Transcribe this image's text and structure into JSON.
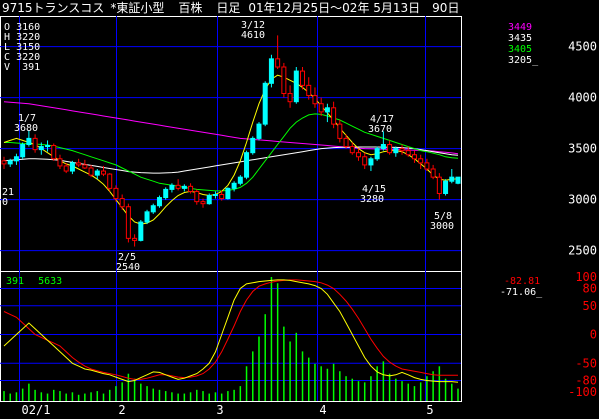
{
  "header": {
    "code": "9715",
    "name": "トランスコス",
    "market": "*東証小型",
    "unit": "百株",
    "period": "日足",
    "range": "01年12月25日～02年 5月13日",
    "days": "90日"
  },
  "ohlc": {
    "o_label": "O",
    "o": "3160",
    "h_label": "H",
    "h": "3220",
    "l_label": "L",
    "l": "3150",
    "c_label": "C",
    "c": "3220",
    "v_label": "V",
    "v": "391"
  },
  "ma_values": [
    {
      "value": "3449",
      "color": "#ff00ff"
    },
    {
      "value": "3435",
      "color": "#ffffff"
    },
    {
      "value": "3405",
      "color": "#00ff00"
    },
    {
      "value": "3205_",
      "color": "#ffffff"
    }
  ],
  "annotations": {
    "jan7_date": "1/7",
    "jan7_price": "3680",
    "mar12_date": "3/12",
    "mar12_price": "4610",
    "apr17_date": "4/17",
    "apr17_price": "3670",
    "apr15_date": "4/15",
    "apr15_price": "3280",
    "feb5_date": "2/5",
    "feb5_price": "2540",
    "may8_date": "5/8",
    "may8_price": "3000",
    "left_a": "21",
    "left_b": "0"
  },
  "lower": {
    "vol_label": "391",
    "vol2_label": "5633",
    "osc1": "-82.81",
    "osc2": "-71.06_"
  },
  "axis": {
    "price_ticks": [
      "4500",
      "4000",
      "3500",
      "3000",
      "2500"
    ],
    "osc_ticks": [
      "100",
      "80",
      "50",
      "0",
      "-50",
      "-80",
      "-100"
    ],
    "x_labels": [
      "02/1",
      "2",
      "3",
      "4",
      "5"
    ]
  },
  "colors": {
    "bg": "#000000",
    "grid": "#0000ff",
    "up": "#00ffff",
    "down": "#ff0000",
    "ma_long": "#ff00ff",
    "ma_mid": "#ffffff",
    "ma_short": "#00ff00",
    "volume": "#00ff00",
    "osc_k": "#ffff00",
    "osc_d": "#ff0000",
    "label_red": "#ff0000",
    "label_white": "#ffffff"
  },
  "chart_data": {
    "type": "candlestick",
    "title": "9715トランスコス *東証小型 百株 日足 01年12月25日～02年 5月13日 90日",
    "ylim": [
      2300,
      4800
    ],
    "candles": [
      [
        3380,
        3420,
        3300,
        3350
      ],
      [
        3350,
        3400,
        3320,
        3380
      ],
      [
        3380,
        3450,
        3340,
        3420
      ],
      [
        3420,
        3560,
        3400,
        3540
      ],
      [
        3540,
        3680,
        3520,
        3600
      ],
      [
        3600,
        3640,
        3460,
        3490
      ],
      [
        3490,
        3560,
        3440,
        3520
      ],
      [
        3520,
        3580,
        3470,
        3530
      ],
      [
        3530,
        3550,
        3380,
        3400
      ],
      [
        3400,
        3440,
        3300,
        3330
      ],
      [
        3330,
        3360,
        3260,
        3280
      ],
      [
        3280,
        3380,
        3250,
        3360
      ],
      [
        3360,
        3400,
        3320,
        3340
      ],
      [
        3340,
        3390,
        3300,
        3310
      ],
      [
        3310,
        3340,
        3220,
        3240
      ],
      [
        3240,
        3300,
        3200,
        3280
      ],
      [
        3280,
        3330,
        3230,
        3250
      ],
      [
        3250,
        3260,
        3080,
        3110
      ],
      [
        3110,
        3140,
        2980,
        3010
      ],
      [
        3010,
        3050,
        2900,
        2930
      ],
      [
        2930,
        2960,
        2580,
        2620
      ],
      [
        2620,
        2660,
        2540,
        2600
      ],
      [
        2600,
        2800,
        2590,
        2780
      ],
      [
        2780,
        2900,
        2760,
        2880
      ],
      [
        2880,
        2960,
        2860,
        2940
      ],
      [
        2940,
        3040,
        2920,
        3020
      ],
      [
        3020,
        3120,
        3000,
        3100
      ],
      [
        3100,
        3160,
        3070,
        3140
      ],
      [
        3140,
        3200,
        3090,
        3110
      ],
      [
        3110,
        3150,
        3080,
        3130
      ],
      [
        3130,
        3160,
        3060,
        3080
      ],
      [
        3080,
        3100,
        2950,
        2980
      ],
      [
        2980,
        3010,
        2920,
        2960
      ],
      [
        2960,
        3060,
        2950,
        3040
      ],
      [
        3040,
        3080,
        3010,
        3050
      ],
      [
        3050,
        3090,
        2990,
        3010
      ],
      [
        3010,
        3120,
        3000,
        3110
      ],
      [
        3110,
        3180,
        3080,
        3160
      ],
      [
        3160,
        3240,
        3140,
        3220
      ],
      [
        3220,
        3480,
        3200,
        3460
      ],
      [
        3460,
        3620,
        3440,
        3600
      ],
      [
        3600,
        3760,
        3580,
        3740
      ],
      [
        3740,
        4160,
        3720,
        4140
      ],
      [
        4140,
        4420,
        4100,
        4380
      ],
      [
        4380,
        4610,
        4280,
        4300
      ],
      [
        4300,
        4340,
        4000,
        4040
      ],
      [
        4040,
        4120,
        3900,
        3960
      ],
      [
        3960,
        4300,
        3940,
        4260
      ],
      [
        4260,
        4300,
        4080,
        4120
      ],
      [
        4120,
        4200,
        3980,
        4020
      ],
      [
        4020,
        4100,
        3900,
        3940
      ],
      [
        3940,
        4000,
        3820,
        3860
      ],
      [
        3860,
        3940,
        3760,
        3900
      ],
      [
        3900,
        3960,
        3700,
        3740
      ],
      [
        3740,
        3780,
        3560,
        3600
      ],
      [
        3600,
        3640,
        3500,
        3520
      ],
      [
        3520,
        3560,
        3440,
        3460
      ],
      [
        3460,
        3500,
        3380,
        3420
      ],
      [
        3420,
        3460,
        3300,
        3340
      ],
      [
        3340,
        3420,
        3280,
        3400
      ],
      [
        3400,
        3520,
        3380,
        3500
      ],
      [
        3500,
        3670,
        3480,
        3540
      ],
      [
        3540,
        3580,
        3440,
        3460
      ],
      [
        3460,
        3520,
        3420,
        3500
      ],
      [
        3500,
        3540,
        3440,
        3480
      ],
      [
        3480,
        3520,
        3420,
        3440
      ],
      [
        3440,
        3480,
        3360,
        3400
      ],
      [
        3400,
        3440,
        3300,
        3360
      ],
      [
        3360,
        3400,
        3280,
        3300
      ],
      [
        3300,
        3340,
        3200,
        3220
      ],
      [
        3220,
        3260,
        3000,
        3060
      ],
      [
        3060,
        3200,
        3040,
        3180
      ],
      [
        3180,
        3300,
        3160,
        3220
      ],
      [
        3160,
        3220,
        3150,
        3220
      ]
    ],
    "ma_long": [
      3960,
      3955,
      3950,
      3945,
      3940,
      3930,
      3920,
      3910,
      3900,
      3890,
      3880,
      3870,
      3860,
      3850,
      3840,
      3830,
      3820,
      3810,
      3800,
      3790,
      3780,
      3770,
      3760,
      3750,
      3740,
      3730,
      3720,
      3710,
      3700,
      3690,
      3680,
      3670,
      3660,
      3650,
      3640,
      3630,
      3620,
      3610,
      3600,
      3595,
      3590,
      3585,
      3580,
      3575,
      3570,
      3565,
      3560,
      3555,
      3550,
      3545,
      3540,
      3535,
      3530,
      3525,
      3520,
      3515,
      3510,
      3505,
      3500,
      3498,
      3496,
      3494,
      3492,
      3490,
      3488,
      3486,
      3484,
      3482,
      3480,
      3476,
      3470,
      3464,
      3458,
      3449
    ],
    "ma_mid": [
      3380,
      3385,
      3390,
      3395,
      3400,
      3400,
      3398,
      3395,
      3390,
      3385,
      3375,
      3365,
      3355,
      3345,
      3335,
      3325,
      3315,
      3305,
      3295,
      3285,
      3275,
      3270,
      3265,
      3262,
      3260,
      3260,
      3262,
      3265,
      3270,
      3280,
      3290,
      3300,
      3310,
      3320,
      3330,
      3340,
      3350,
      3360,
      3370,
      3380,
      3390,
      3400,
      3410,
      3420,
      3430,
      3440,
      3450,
      3460,
      3470,
      3480,
      3490,
      3500,
      3505,
      3510,
      3512,
      3514,
      3515,
      3516,
      3516,
      3516,
      3516,
      3515,
      3514,
      3512,
      3510,
      3505,
      3500,
      3490,
      3480,
      3470,
      3460,
      3450,
      3440,
      3435
    ],
    "ma_short": [
      3560,
      3560,
      3555,
      3550,
      3548,
      3545,
      3540,
      3535,
      3525,
      3510,
      3495,
      3480,
      3460,
      3440,
      3420,
      3400,
      3380,
      3360,
      3340,
      3310,
      3280,
      3250,
      3220,
      3200,
      3180,
      3160,
      3150,
      3140,
      3130,
      3120,
      3110,
      3100,
      3095,
      3090,
      3085,
      3085,
      3090,
      3100,
      3120,
      3160,
      3220,
      3300,
      3380,
      3460,
      3540,
      3620,
      3700,
      3760,
      3800,
      3830,
      3840,
      3835,
      3820,
      3800,
      3780,
      3750,
      3720,
      3690,
      3660,
      3640,
      3620,
      3600,
      3580,
      3560,
      3540,
      3520,
      3500,
      3480,
      3470,
      3455,
      3440,
      3420,
      3410,
      3405
    ],
    "ma_fast": [
      3560,
      3580,
      3600,
      3580,
      3560,
      3540,
      3500,
      3460,
      3420,
      3380,
      3350,
      3330,
      3300,
      3270,
      3240,
      3200,
      3150,
      3080,
      3000,
      2920,
      2840,
      2780,
      2760,
      2770,
      2800,
      2860,
      2930,
      2990,
      3040,
      3070,
      3080,
      3070,
      3050,
      3040,
      3050,
      3080,
      3140,
      3240,
      3380,
      3560,
      3760,
      3940,
      4080,
      4180,
      4220,
      4200,
      4170,
      4140,
      4100,
      4050,
      3990,
      3920,
      3850,
      3780,
      3700,
      3630,
      3560,
      3500,
      3460,
      3440,
      3450,
      3470,
      3480,
      3480,
      3470,
      3440,
      3400,
      3350,
      3300,
      3240,
      3200,
      3190,
      3200,
      3205
    ],
    "volume": [
      8,
      6,
      7,
      10,
      14,
      9,
      7,
      6,
      9,
      8,
      6,
      7,
      5,
      6,
      7,
      8,
      6,
      9,
      12,
      15,
      22,
      18,
      14,
      12,
      10,
      9,
      8,
      7,
      6,
      6,
      7,
      9,
      8,
      6,
      7,
      6,
      8,
      9,
      12,
      28,
      40,
      52,
      70,
      100,
      95,
      60,
      48,
      55,
      40,
      35,
      30,
      28,
      26,
      30,
      24,
      20,
      18,
      16,
      15,
      20,
      28,
      32,
      22,
      18,
      16,
      14,
      12,
      15,
      20,
      24,
      28,
      18,
      14,
      10
    ],
    "osc_k": [
      -20,
      -10,
      0,
      10,
      20,
      10,
      0,
      -10,
      -20,
      -30,
      -40,
      -50,
      -55,
      -60,
      -62,
      -65,
      -68,
      -70,
      -74,
      -78,
      -82,
      -80,
      -75,
      -70,
      -65,
      -66,
      -70,
      -74,
      -78,
      -76,
      -72,
      -68,
      -60,
      -50,
      -30,
      0,
      30,
      60,
      80,
      88,
      90,
      92,
      93,
      94,
      95,
      95,
      94,
      92,
      90,
      88,
      85,
      80,
      70,
      55,
      40,
      20,
      0,
      -20,
      -40,
      -55,
      -65,
      -70,
      -72,
      -70,
      -66,
      -70,
      -75,
      -78,
      -80,
      -81,
      -82,
      -82,
      -82,
      -83
    ],
    "osc_d": [
      40,
      35,
      30,
      20,
      10,
      0,
      -5,
      -10,
      -15,
      -20,
      -30,
      -40,
      -48,
      -55,
      -60,
      -63,
      -66,
      -68,
      -70,
      -73,
      -76,
      -78,
      -78,
      -76,
      -73,
      -70,
      -70,
      -72,
      -74,
      -75,
      -74,
      -72,
      -68,
      -60,
      -48,
      -30,
      -8,
      15,
      40,
      60,
      75,
      84,
      88,
      91,
      93,
      94,
      95,
      95,
      94,
      93,
      92,
      90,
      86,
      80,
      70,
      58,
      44,
      28,
      10,
      -8,
      -24,
      -38,
      -48,
      -55,
      -60,
      -62,
      -64,
      -66,
      -68,
      -70,
      -71,
      -71,
      -71,
      -71
    ],
    "points": [
      {
        "date": "1/7",
        "price": 3680
      },
      {
        "date": "2/5",
        "price": 2540
      },
      {
        "date": "3/12",
        "price": 4610
      },
      {
        "date": "4/15",
        "price": 3280
      },
      {
        "date": "4/17",
        "price": 3670
      },
      {
        "date": "5/8",
        "price": 3000
      }
    ],
    "yticks": [
      2500,
      3000,
      3500,
      4000,
      4500
    ],
    "osc_yticks": [
      -100,
      -80,
      -50,
      0,
      50,
      80,
      100
    ]
  }
}
